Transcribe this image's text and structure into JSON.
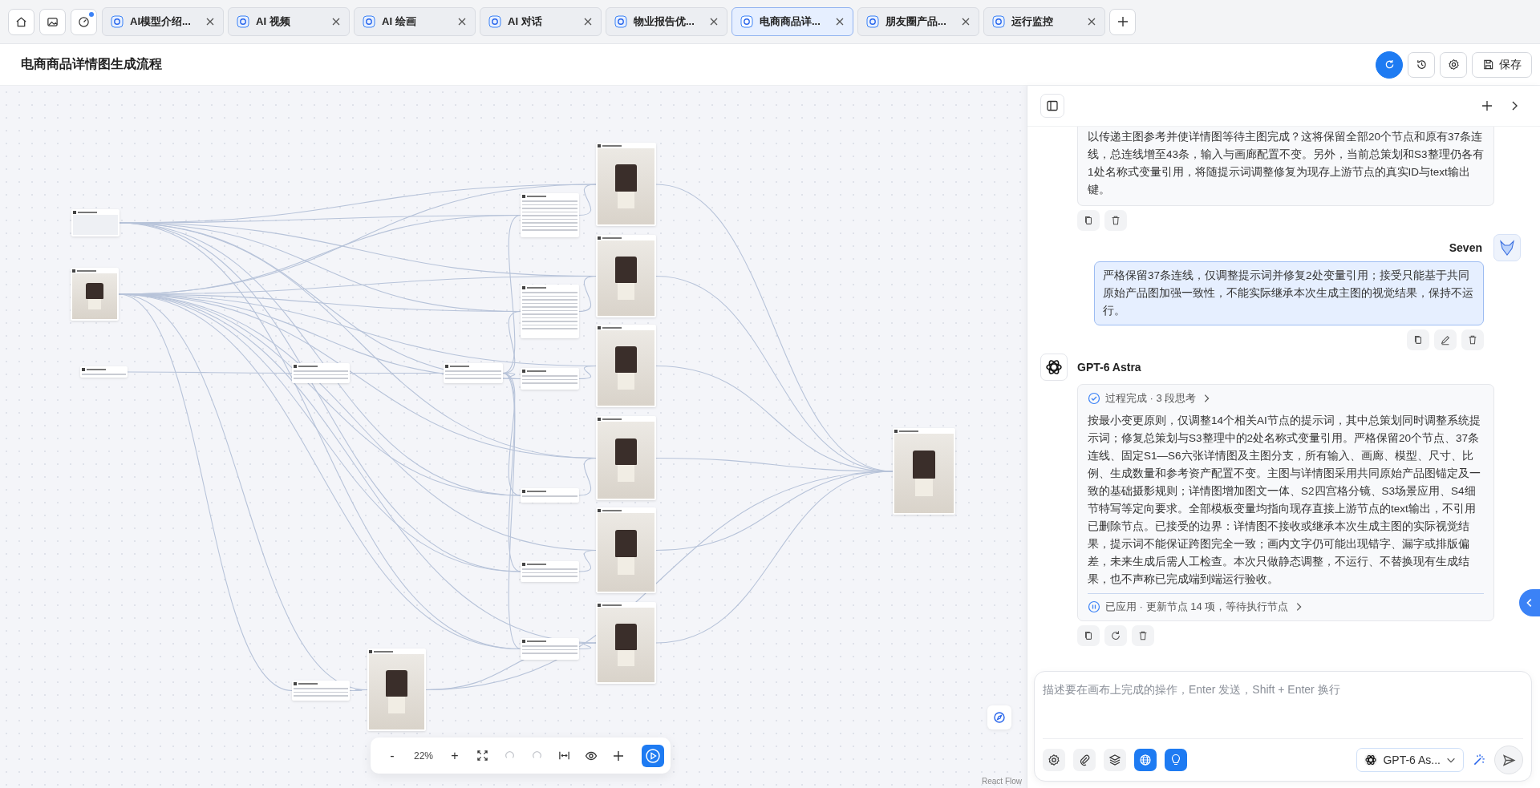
{
  "tab_bar": {
    "tabs": [
      {
        "label": "AI模型介绍...",
        "selected": false
      },
      {
        "label": "AI 视频",
        "selected": false
      },
      {
        "label": "AI 绘画",
        "selected": false
      },
      {
        "label": "AI 对话",
        "selected": false
      },
      {
        "label": "物业报告优...",
        "selected": false
      },
      {
        "label": "电商商品详...",
        "selected": true
      },
      {
        "label": "朋友圈产品...",
        "selected": false
      },
      {
        "label": "运行监控",
        "selected": false
      }
    ]
  },
  "header": {
    "title": "电商商品详情图生成流程",
    "save_button": "保存"
  },
  "canvas": {
    "toolbar": {
      "zoom_out": "-",
      "zoom": "22%",
      "zoom_in": "+",
      "undo_disabled": true,
      "redo_disabled": true
    },
    "attribution": "React Flow"
  },
  "chat": {
    "messages": [
      {
        "kind": "assistant",
        "text": "以传递主图参考并使详情图等待主图完成？这将保留全部20个节点和原有37条连线，总连线增至43条，输入与画廊配置不变。另外，当前总策划和S3整理仍各有1处名称式变量引用，将随提示词调整修复为现存上游节点的真实ID与text输出键。",
        "actions": [
          {
            "kind": "copy"
          },
          {
            "kind": "delete"
          }
        ]
      },
      {
        "kind": "user",
        "author": "Seven",
        "text": "严格保留37条连线，仅调整提示词并修复2处变量引用；接受只能基于共同原始产品图加强一致性，不能实际继承本次生成主图的视觉结果，保持不运行。",
        "actions": [
          {
            "kind": "copy"
          },
          {
            "kind": "edit"
          },
          {
            "kind": "delete"
          }
        ]
      },
      {
        "kind": "assistant",
        "author": "GPT-6 Astra",
        "process": "过程完成 · 3 段思考",
        "text": "按最小变更原则，仅调整14个相关AI节点的提示词，其中总策划同时调整系统提示词；修复总策划与S3整理中的2处名称式变量引用。严格保留20个节点、37条连线、固定S1—S6六张详情图及主图分支，所有输入、画廊、模型、尺寸、比例、生成数量和参考资产配置不变。主图与详情图采用共同原始产品图锚定及一致的基础摄影规则；详情图增加图文一体、S2四宫格分镜、S3场景应用、S4细节特写等定向要求。全部模板变量均指向现存直接上游节点的text输出，不引用已删除节点。已接受的边界：详情图不接收或继承本次生成主图的实际视觉结果，提示词不能保证跨图完全一致；画内文字仍可能出现错字、漏字或排版偏差，未来生成后需人工检查。本次只做静态调整，不运行、不替换现有生成结果，也不声称已完成端到端运行验收。",
        "status": "已应用 · 更新节点 14 项，等待执行节点",
        "actions": [
          {
            "kind": "copy"
          },
          {
            "kind": "regenerate"
          },
          {
            "kind": "delete"
          }
        ]
      }
    ],
    "composer": {
      "placeholder": "描述要在画布上完成的操作，Enter 发送，Shift + Enter 换行",
      "model": "GPT-6 As...",
      "web_search_on": true,
      "ideas_on": true
    }
  }
}
